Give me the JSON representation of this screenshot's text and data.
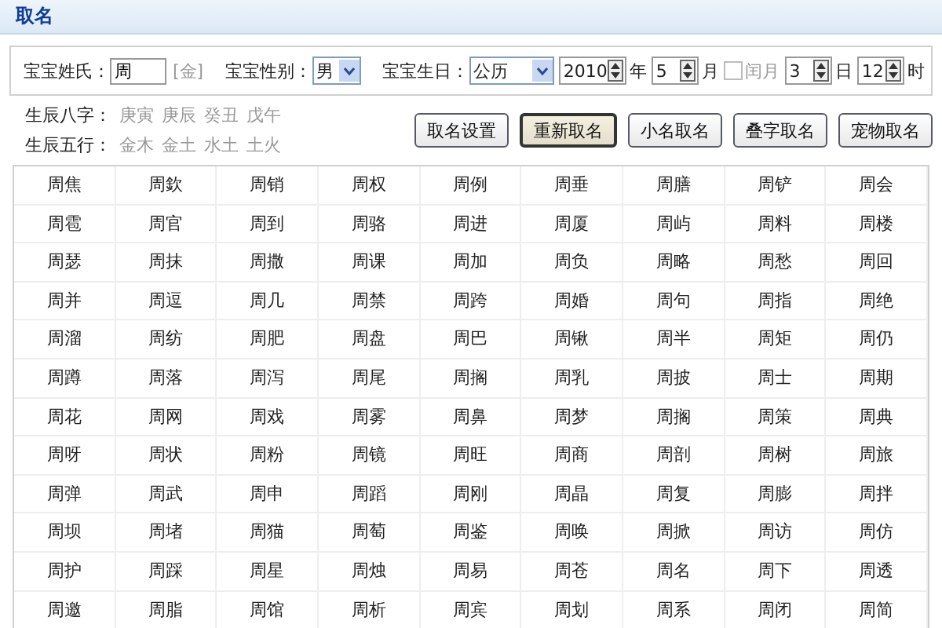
{
  "header": {
    "title": "取名"
  },
  "form": {
    "surname_label": "宝宝姓氏：",
    "surname": "周",
    "surname_element": "[金]",
    "gender_label": "宝宝性别：",
    "gender": "男",
    "birthday_label": "宝宝生日：",
    "calendar": "公历",
    "year": "2010",
    "year_unit": "年",
    "month": "5",
    "month_unit": "月",
    "leap_month": {
      "label": "闰月",
      "checked": false
    },
    "day": "3",
    "day_unit": "日",
    "hour": "12",
    "hour_unit": "时"
  },
  "bazi": {
    "label": "生辰八字：",
    "values": [
      "庚寅",
      "庚辰",
      "癸丑",
      "戊午"
    ]
  },
  "wuxing": {
    "label": "生辰五行：",
    "values": [
      "金木",
      "金土",
      "水土",
      "土火"
    ]
  },
  "buttons": [
    {
      "label": "取名设置",
      "selected": false
    },
    {
      "label": "重新取名",
      "selected": true
    },
    {
      "label": "小名取名",
      "selected": false
    },
    {
      "label": "叠字取名",
      "selected": false
    },
    {
      "label": "宠物取名",
      "selected": false
    }
  ],
  "names": [
    [
      "周焦",
      "周欽",
      "周销",
      "周权",
      "周例",
      "周垂",
      "周膳",
      "周铲",
      "周会"
    ],
    [
      "周雹",
      "周官",
      "周到",
      "周骆",
      "周进",
      "周厦",
      "周屿",
      "周料",
      "周楼"
    ],
    [
      "周瑟",
      "周抹",
      "周撒",
      "周课",
      "周加",
      "周负",
      "周略",
      "周愁",
      "周回"
    ],
    [
      "周并",
      "周逗",
      "周几",
      "周禁",
      "周跨",
      "周婚",
      "周句",
      "周指",
      "周绝"
    ],
    [
      "周溜",
      "周纺",
      "周肥",
      "周盘",
      "周巴",
      "周锹",
      "周半",
      "周矩",
      "周仍"
    ],
    [
      "周蹲",
      "周落",
      "周泻",
      "周尾",
      "周搁",
      "周乳",
      "周披",
      "周士",
      "周期"
    ],
    [
      "周花",
      "周网",
      "周戏",
      "周雾",
      "周鼻",
      "周梦",
      "周搁",
      "周策",
      "周典"
    ],
    [
      "周呀",
      "周状",
      "周粉",
      "周镜",
      "周旺",
      "周商",
      "周剖",
      "周树",
      "周旅"
    ],
    [
      "周弹",
      "周武",
      "周申",
      "周蹈",
      "周刚",
      "周晶",
      "周复",
      "周膨",
      "周拌"
    ],
    [
      "周坝",
      "周堵",
      "周猫",
      "周萄",
      "周鉴",
      "周唤",
      "周掀",
      "周访",
      "周仿"
    ],
    [
      "周护",
      "周踩",
      "周星",
      "周烛",
      "周易",
      "周苍",
      "周名",
      "周下",
      "周透"
    ],
    [
      "周邀",
      "周脂",
      "周馆",
      "周析",
      "周宾",
      "周划",
      "周系",
      "周闭",
      "周简"
    ]
  ]
}
